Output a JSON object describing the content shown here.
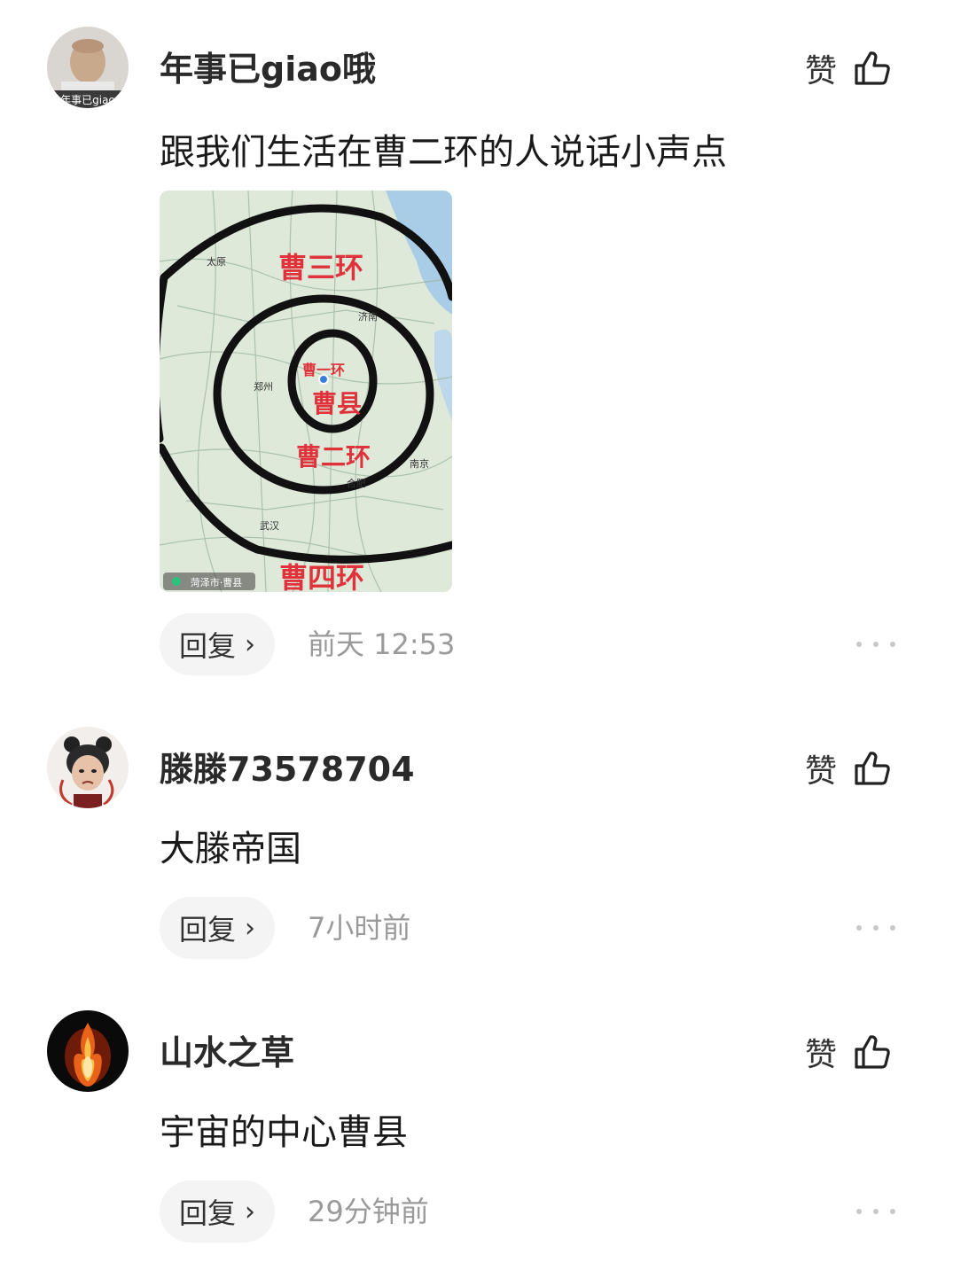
{
  "comments": [
    {
      "username": "年事已giao哦",
      "avatar_caption": "年事已giao",
      "like_label": "赞",
      "text": "跟我们生活在曹二环的人说话小声点",
      "reply_label": "回复",
      "time": "前天 12:53",
      "image": {
        "ring_labels": [
          "曹三环",
          "曹二环",
          "曹一环",
          "曹县",
          "曹四环"
        ],
        "cities": [
          "太原",
          "济南",
          "郑州",
          "合肥",
          "南京",
          "武汉"
        ],
        "footer_location": "菏泽市·曹县"
      }
    },
    {
      "username": "滕滕73578704",
      "like_label": "赞",
      "text": "大滕帝国",
      "reply_label": "回复",
      "time": "7小时前"
    },
    {
      "username": "山水之草",
      "like_label": "赞",
      "text": "宇宙的中心曹县",
      "reply_label": "回复",
      "time": "29分钟前"
    }
  ],
  "colors": {
    "ring_label_red": "#e0323b",
    "map_land": "#dfe9da",
    "map_water": "#a9cde6",
    "time_gray": "#9a9a9a",
    "reply_bg": "#f4f4f4"
  },
  "icons": {
    "like": "thumbs-up-icon",
    "more": "more-dots-icon",
    "reply_chevron": "chevron-right-icon"
  }
}
